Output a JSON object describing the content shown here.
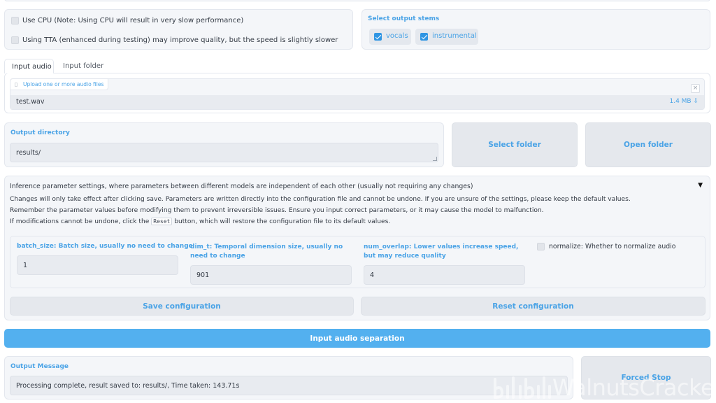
{
  "options": {
    "use_cpu_label": "Use CPU (Note: Using CPU will result in very slow performance)",
    "use_tta_label": "Using TTA (enhanced during testing) may improve quality, but the speed is slightly slower"
  },
  "stems": {
    "title": "Select output stems",
    "items": [
      {
        "label": "vocals",
        "checked": true
      },
      {
        "label": "instrumental",
        "checked": true
      }
    ]
  },
  "tabs": {
    "items": [
      "Input audio",
      "Input folder"
    ],
    "active": "Input audio"
  },
  "upload": {
    "label": "Upload one or more audio files",
    "close_symbol": "×",
    "file_name": "test.wav",
    "file_size": "1.4 MB ⇩"
  },
  "output_dir": {
    "label": "Output directory",
    "value": "results/",
    "select_folder": "Select folder",
    "open_folder": "Open folder"
  },
  "inference": {
    "header": "Inference parameter settings, where parameters between different models are independent of each other (usually not requiring any changes)",
    "toggle": "▼",
    "note1": "Changes will only take effect after clicking save. Parameters are written directly into the configuration file and cannot be undone. If you are unsure of the settings, please keep the default values.",
    "note2": "Remember the parameter values before modifying them to prevent irreversible issues. Ensure you input correct parameters, or it may cause the model to malfunction.",
    "note3_pre": "If modifications cannot be undone, click the",
    "note3_code": "Reset",
    "note3_post": "button, which will restore the configuration file to its default values.",
    "batch_size_label": "batch_size: Batch size, usually no need to change",
    "batch_size_value": "1",
    "dim_t_label": "dim_t: Temporal dimension size, usually no need to change",
    "dim_t_value": "901",
    "num_overlap_label": "num_overlap: Lower values increase speed, but may reduce quality",
    "num_overlap_value": "4",
    "normalize_label": "normalize: Whether to normalize audio",
    "save_button": "Save configuration",
    "reset_button": "Reset configuration"
  },
  "separate_button": "Input audio separation",
  "output": {
    "label": "Output Message",
    "message": "Processing complete, result saved to: results/, Time taken: 143.71s",
    "stop_button": "Forced Stop"
  },
  "watermark": "WalnutsCracker",
  "colors": {
    "accent": "#4aa3e6",
    "primary_button": "#53b0ef"
  }
}
